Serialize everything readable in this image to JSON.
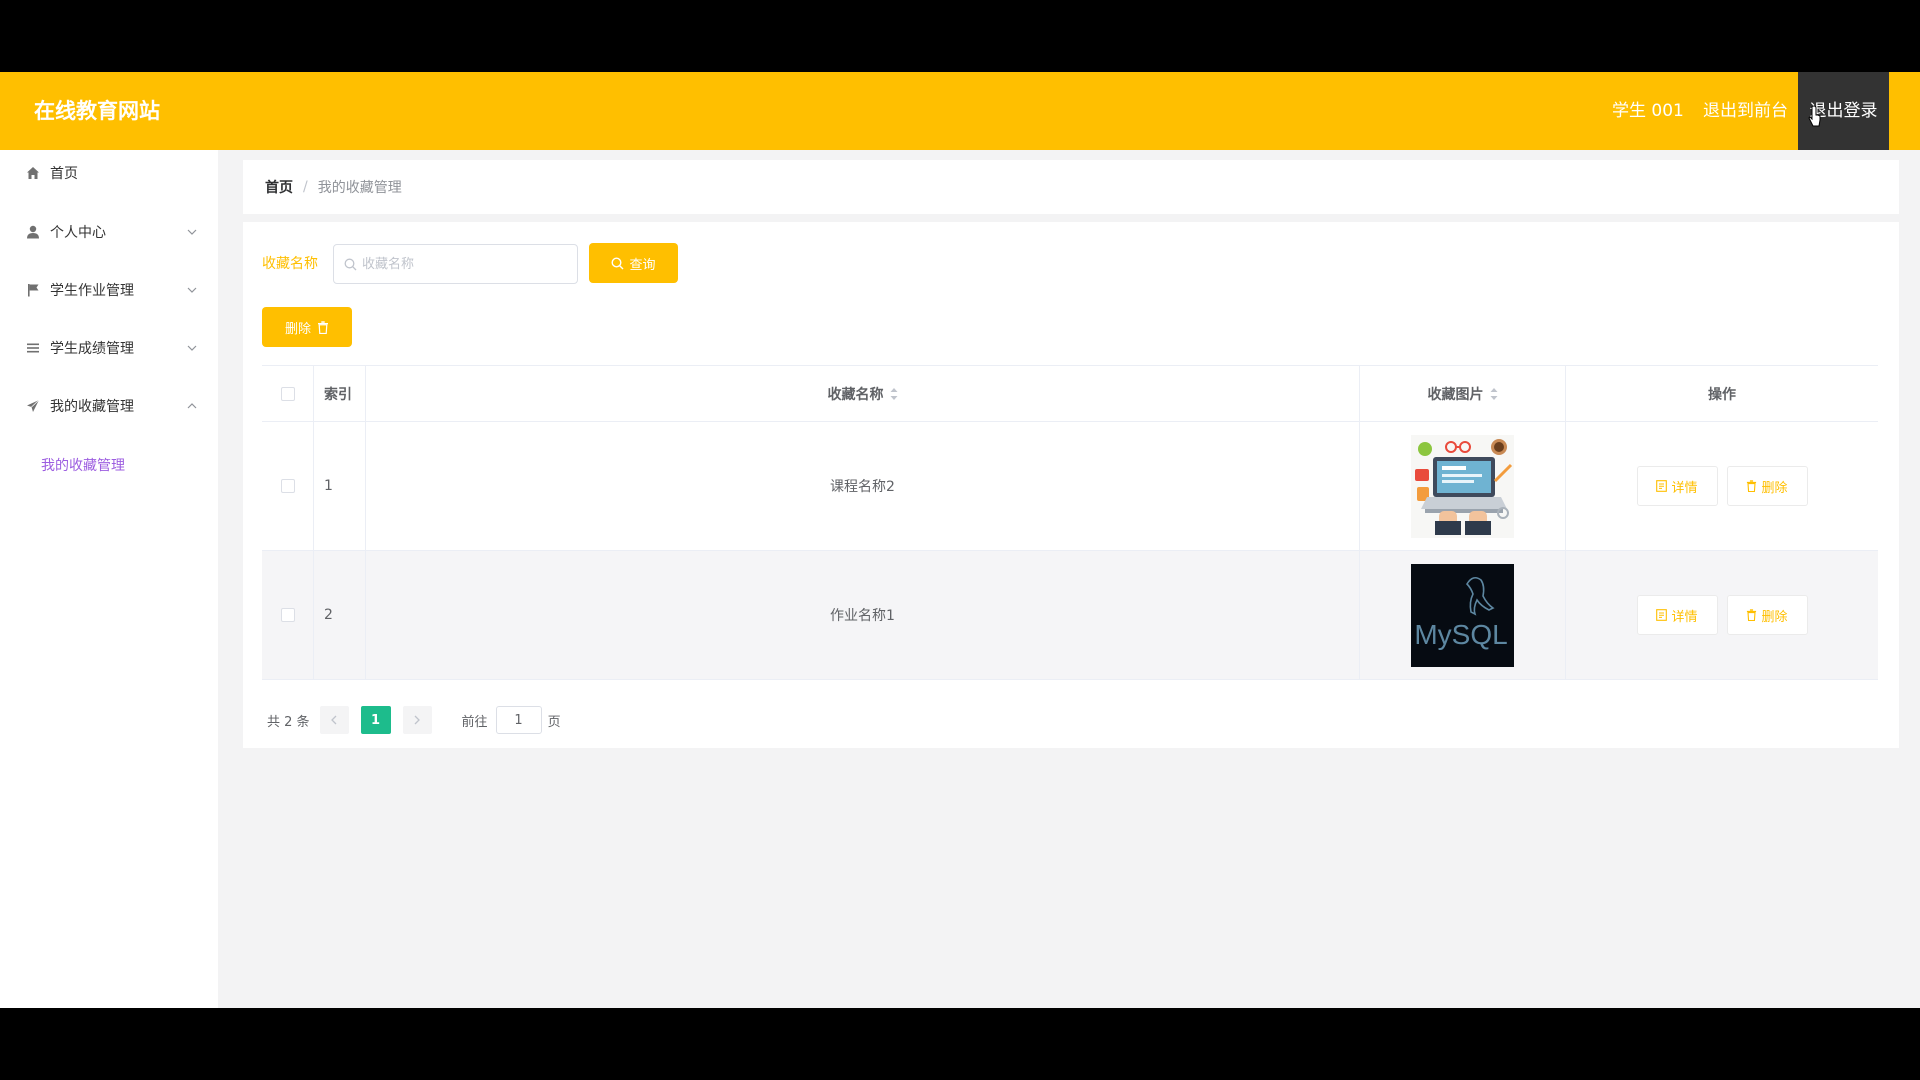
{
  "header": {
    "brand": "在线教育网站",
    "user": "学生 001",
    "front_link": "退出到前台",
    "logout": "退出登录",
    "bg_color": "#ffbf00"
  },
  "sidebar": {
    "items": [
      {
        "label": "首页",
        "icon": "home-icon"
      },
      {
        "label": "个人中心",
        "icon": "user-icon",
        "arrow": "chevron-down-icon"
      },
      {
        "label": "学生作业管理",
        "icon": "flag-icon",
        "arrow": "chevron-down-icon"
      },
      {
        "label": "学生成绩管理",
        "icon": "list-icon",
        "arrow": "chevron-down-icon"
      },
      {
        "label": "我的收藏管理",
        "icon": "send-icon",
        "arrow": "chevron-up-icon"
      }
    ],
    "submenu": {
      "label": "我的收藏管理",
      "color": "#9c5de0"
    }
  },
  "breadcrumb": {
    "home": "首页",
    "separator": "/",
    "current": "我的收藏管理"
  },
  "filter": {
    "label": "收藏名称",
    "placeholder": "收藏名称",
    "query_button": "查询",
    "delete_button": "删除"
  },
  "table": {
    "headers": {
      "index": "索引",
      "name": "收藏名称",
      "image": "收藏图片",
      "action": "操作"
    },
    "rows": [
      {
        "index": "1",
        "name": "课程名称2",
        "image": "laptop-illustration",
        "detail": "详情",
        "delete": "删除"
      },
      {
        "index": "2",
        "name": "作业名称1",
        "image": "mysql-logo",
        "detail": "详情",
        "delete": "删除"
      }
    ]
  },
  "pagination": {
    "total": "共 2 条",
    "current_page": "1",
    "goto_label": "前往",
    "goto_value": "1",
    "page_suffix": "页",
    "active_color": "#1dbc8c"
  },
  "mysql_logo_text": "MySQL"
}
